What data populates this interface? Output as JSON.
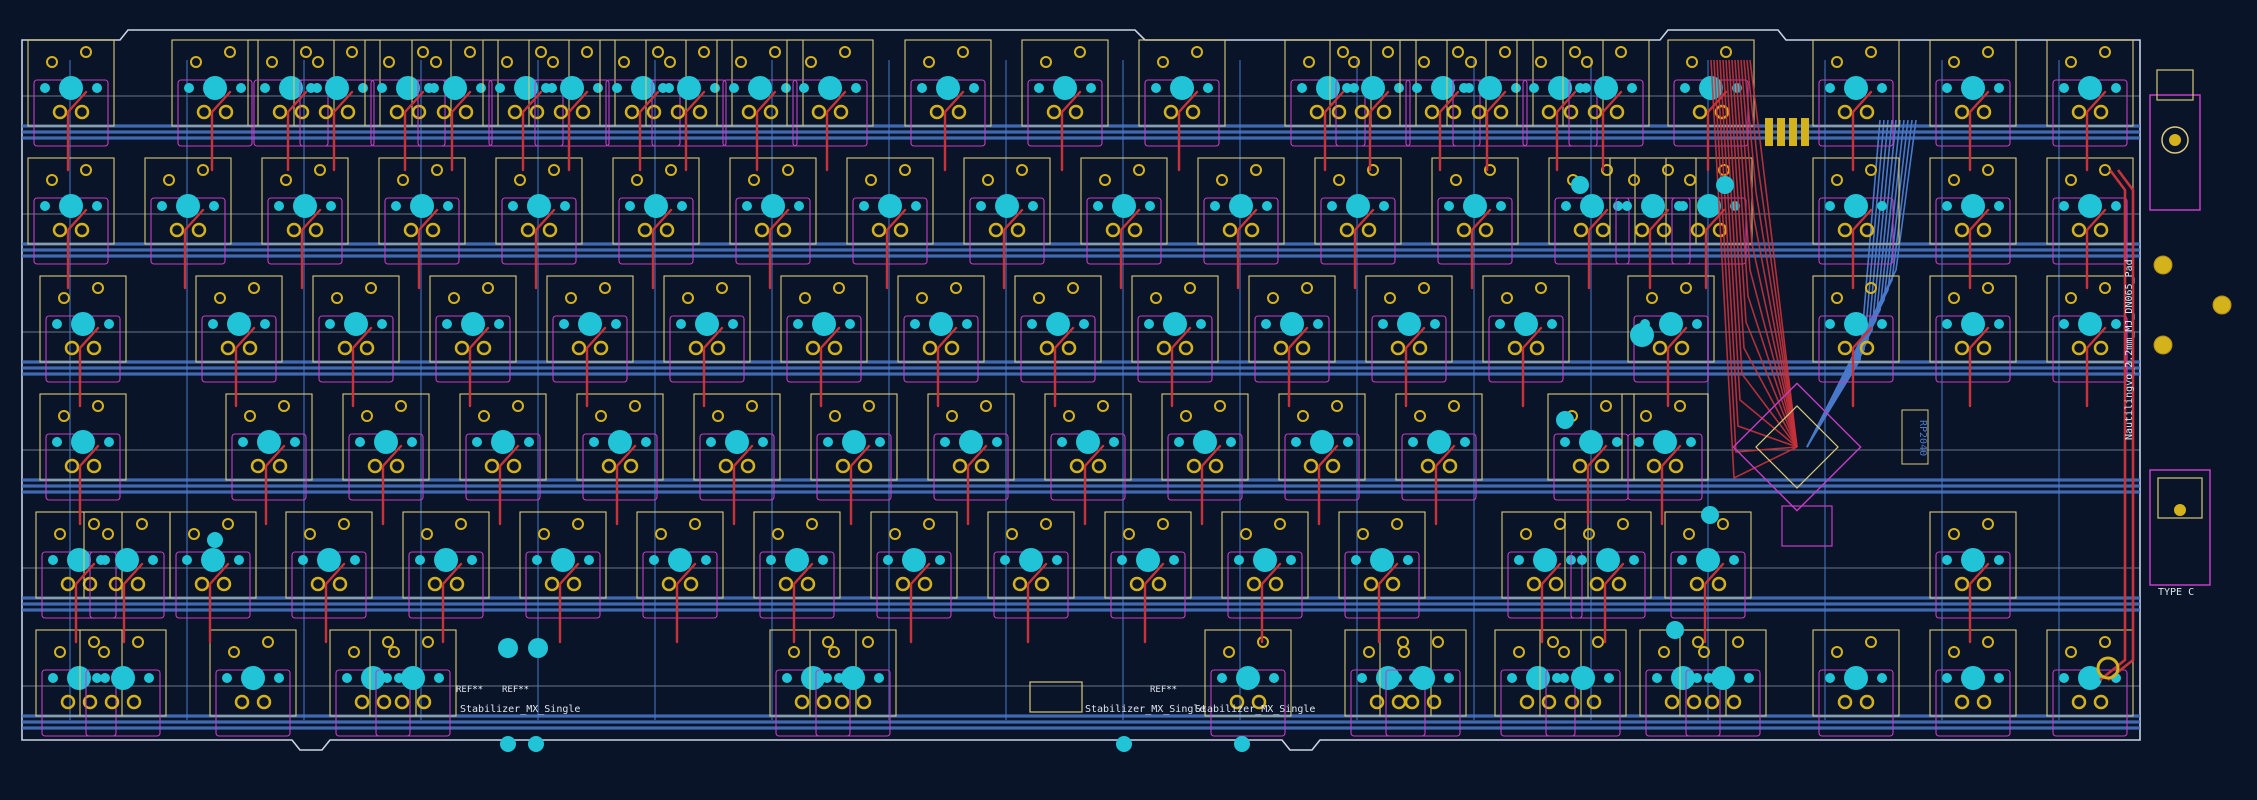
{
  "colors": {
    "background": "#0a1428",
    "outline": "#c9d3e3",
    "silk": "#d7c97a",
    "trace_back": "#4a78c8",
    "trace_front": "#c8323a",
    "pad": "#d4b21c",
    "hole": "#20c4d6",
    "courtyard": "#c43cc4",
    "label": "#dde4ee"
  },
  "labels": {
    "stab_a": "Stabilizer_MX_Single",
    "stab_b": "Stabilizer_MX_Single",
    "stab_c": "Stabilizer_MX_Single",
    "ref_a": "REF**",
    "ref_b": "REF**",
    "ref_c": "REF**",
    "jack": "Nautilingvo_2.2mm_MJ_DN065_Pad",
    "typec": "TYPE C",
    "mcu": "RP2040"
  }
}
